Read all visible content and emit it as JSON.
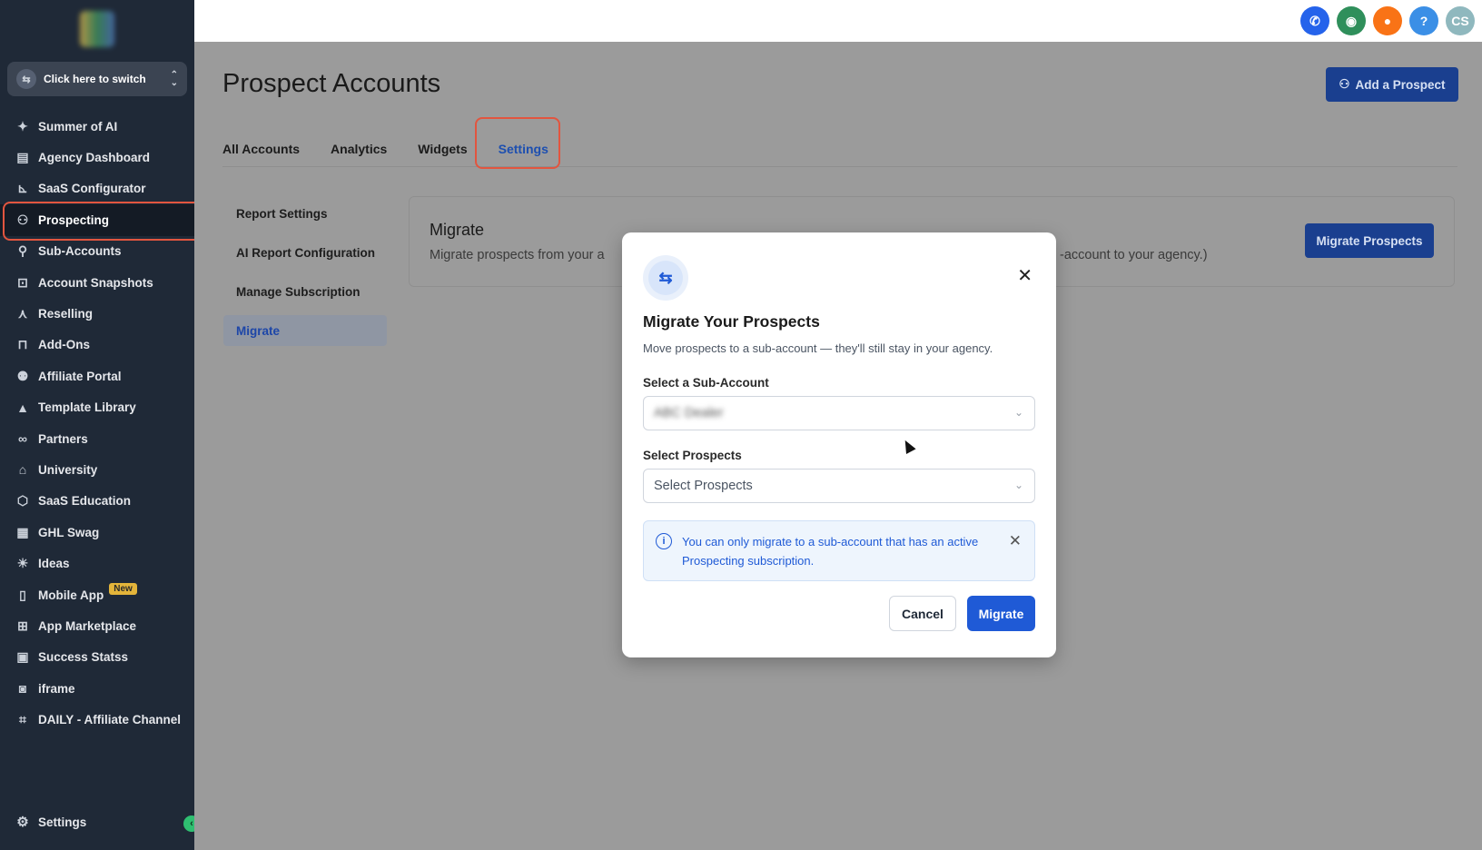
{
  "sidebar": {
    "switcher_label": "Click here to switch",
    "items": [
      {
        "label": "Summer of AI",
        "icon": "sparkle-icon",
        "glyph": "✦"
      },
      {
        "label": "Agency Dashboard",
        "icon": "dashboard-icon",
        "glyph": "▤"
      },
      {
        "label": "SaaS Configurator",
        "icon": "chart-icon",
        "glyph": "⊾"
      },
      {
        "label": "Prospecting",
        "icon": "user-search-icon",
        "glyph": "⚇"
      },
      {
        "label": "Sub-Accounts",
        "icon": "user-icon",
        "glyph": "⚲"
      },
      {
        "label": "Account Snapshots",
        "icon": "snapshot-icon",
        "glyph": "⊡"
      },
      {
        "label": "Reselling",
        "icon": "reselling-icon",
        "glyph": "⋏"
      },
      {
        "label": "Add-Ons",
        "icon": "bag-icon",
        "glyph": "⊓"
      },
      {
        "label": "Affiliate Portal",
        "icon": "users-icon",
        "glyph": "⚉"
      },
      {
        "label": "Template Library",
        "icon": "shapes-icon",
        "glyph": "▲"
      },
      {
        "label": "Partners",
        "icon": "handshake-icon",
        "glyph": "∞"
      },
      {
        "label": "University",
        "icon": "graduation-icon",
        "glyph": "⌂"
      },
      {
        "label": "SaaS Education",
        "icon": "cube-icon",
        "glyph": "⬡"
      },
      {
        "label": "GHL Swag",
        "icon": "store-icon",
        "glyph": "▦"
      },
      {
        "label": "Ideas",
        "icon": "lightbulb-icon",
        "glyph": "☀"
      },
      {
        "label": "Mobile App",
        "icon": "mobile-icon",
        "glyph": "▯",
        "badge": "New"
      },
      {
        "label": "App Marketplace",
        "icon": "grid-icon",
        "glyph": "⊞"
      },
      {
        "label": "Success Statss",
        "icon": "stats-icon",
        "glyph": "▣"
      },
      {
        "label": "iframe",
        "icon": "glasses-icon",
        "glyph": "◙"
      },
      {
        "label": "DAILY - Affiliate Channel",
        "icon": "frame-icon",
        "glyph": "⌗"
      }
    ],
    "settings_label": "Settings",
    "collapse_glyph": "‹"
  },
  "topbar": {
    "icons": [
      {
        "name": "phone-icon",
        "color": "#2563eb",
        "glyph": "✆"
      },
      {
        "name": "megaphone-icon",
        "color": "#2f8f5b",
        "glyph": "◉"
      },
      {
        "name": "notification-icon",
        "color": "#f97316",
        "glyph": "●"
      },
      {
        "name": "help-icon",
        "color": "#3b8fe6",
        "glyph": "?"
      },
      {
        "name": "avatar",
        "color": "#8fb8be",
        "glyph": "CS"
      }
    ]
  },
  "page": {
    "title": "Prospect Accounts",
    "add_button": "Add a Prospect",
    "tabs": [
      "All Accounts",
      "Analytics",
      "Widgets",
      "Settings"
    ],
    "active_tab": "Settings",
    "settings_menu": [
      "Report Settings",
      "AI Report Configuration",
      "Manage Subscription",
      "Migrate"
    ],
    "active_menu": "Migrate",
    "card": {
      "title": "Migrate",
      "desc_start": "Migrate prospects from your a",
      "desc_end": "-account to your agency.)",
      "button": "Migrate Prospects"
    }
  },
  "modal": {
    "title": "Migrate Your Prospects",
    "subtitle": "Move prospects to a sub-account — they'll still stay in your agency.",
    "sub_account_label": "Select a Sub-Account",
    "sub_account_value": "ABC Dealer",
    "prospects_label": "Select Prospects",
    "prospects_placeholder": "Select Prospects",
    "info_text": "You can only migrate to a sub-account that has an active Prospecting subscription.",
    "cancel_label": "Cancel",
    "migrate_label": "Migrate"
  },
  "colors": {
    "accent": "#1f5ad6",
    "highlight": "#e2553f",
    "sidebar_bg": "#1f2937"
  }
}
